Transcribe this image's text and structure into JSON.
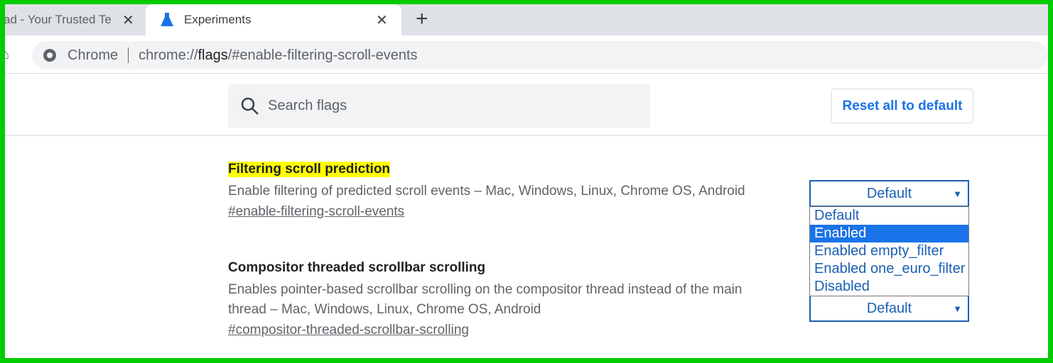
{
  "tabs": [
    {
      "label": "ad - Your Trusted Te",
      "active": false
    },
    {
      "label": "Experiments",
      "active": true
    }
  ],
  "address": {
    "site_label": "Chrome",
    "url_prefix": "chrome://",
    "url_host": "flags",
    "url_rest": "/#enable-filtering-scroll-events"
  },
  "search": {
    "placeholder": "Search flags"
  },
  "reset_label": "Reset all to default",
  "experiments": [
    {
      "title": "Filtering scroll prediction",
      "highlighted": true,
      "description": "Enable filtering of predicted scroll events – Mac, Windows, Linux, Chrome OS, Android",
      "link": "#enable-filtering-scroll-events",
      "selected": "Default"
    },
    {
      "title": "Compositor threaded scrollbar scrolling",
      "description": "Enables pointer-based scrollbar scrolling on the compositor thread instead of the main thread – Mac, Windows, Linux, Chrome OS, Android",
      "link": "#compositor-threaded-scrollbar-scrolling",
      "selected": "Default"
    }
  ],
  "dropdown_options": [
    "Default",
    "Enabled",
    "Enabled empty_filter",
    "Enabled one_euro_filter",
    "Disabled"
  ],
  "dropdown_highlighted": "Enabled",
  "colors": {
    "border": "#00cc00",
    "highlight": "#ffff00",
    "link_blue": "#1a73e8"
  }
}
